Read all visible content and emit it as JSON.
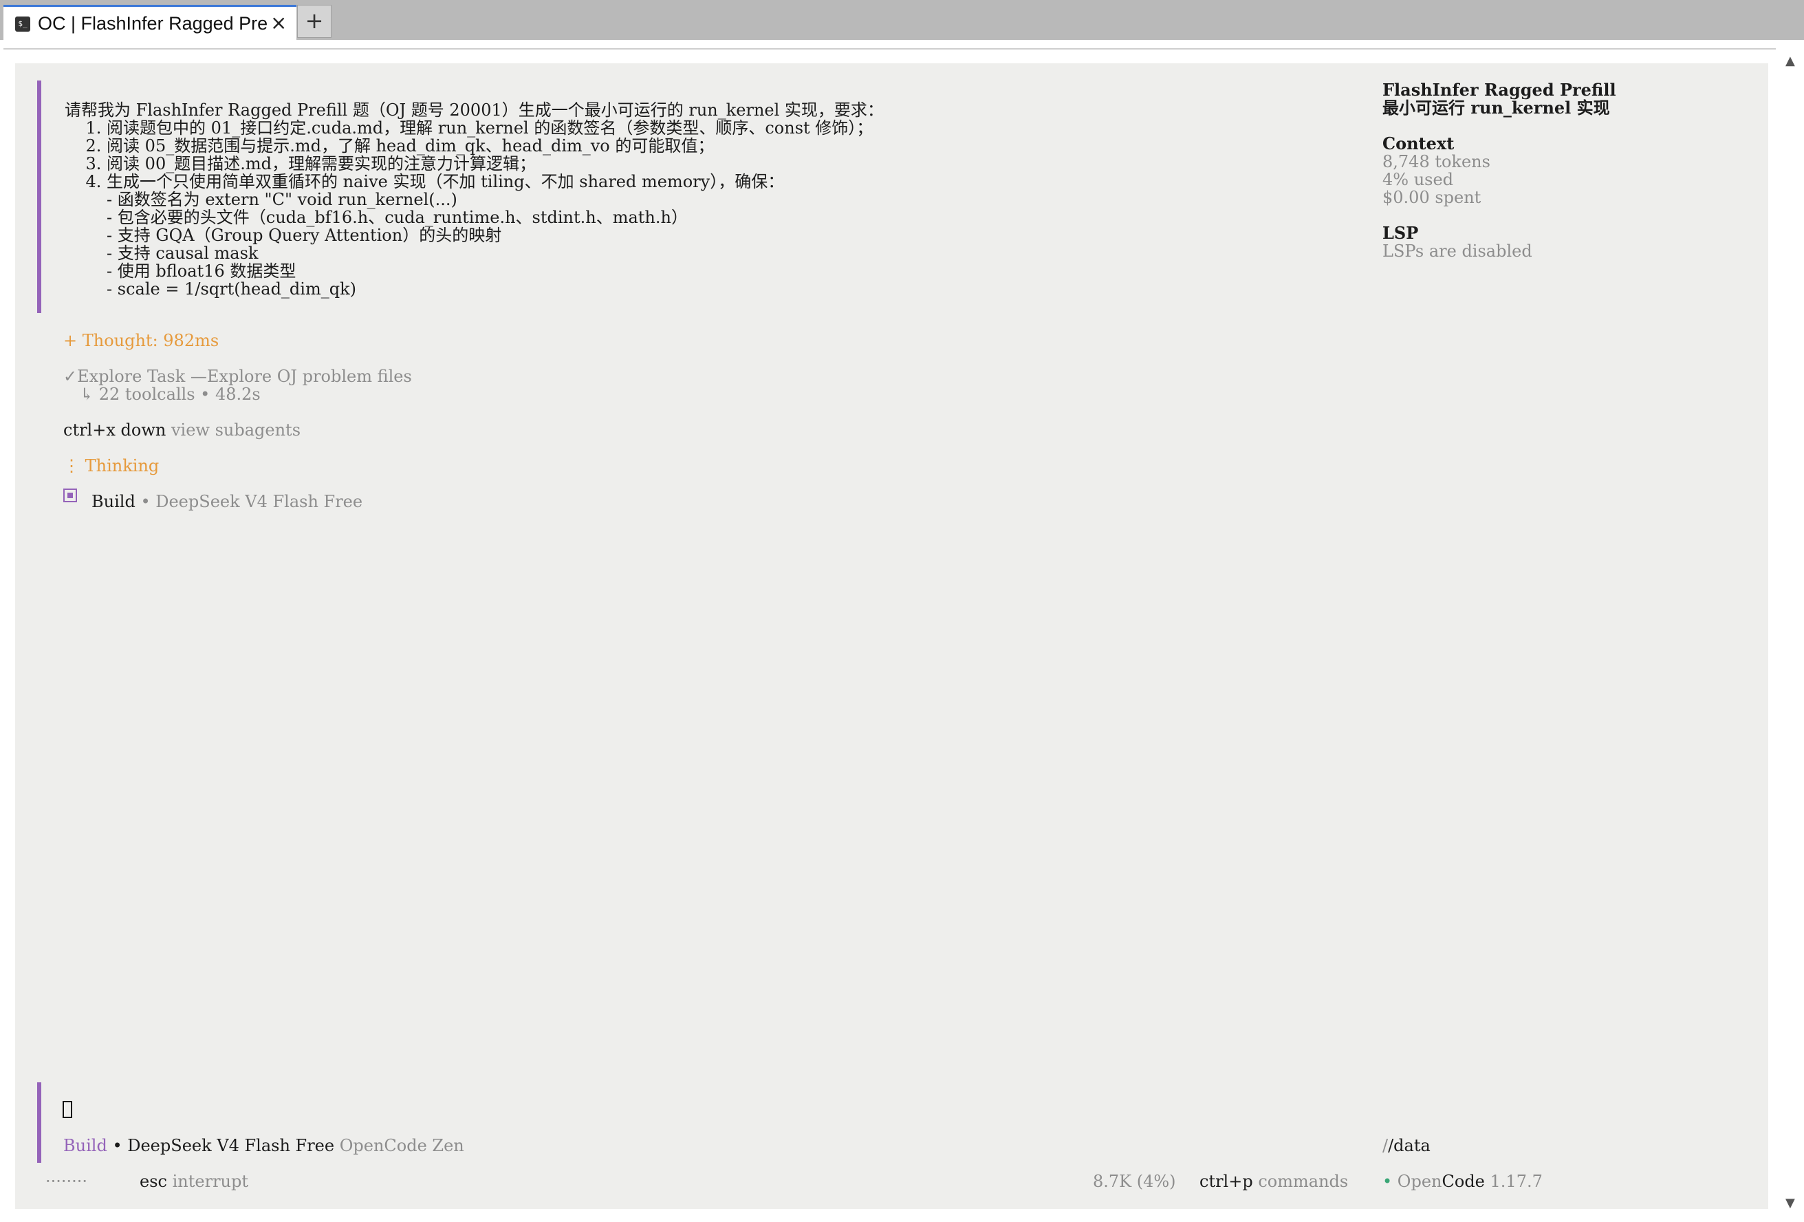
{
  "tab": {
    "icon_text": "$_",
    "title": "OC | FlashInfer Ragged Pre",
    "close_icon": "×",
    "new_tab_label": "+"
  },
  "scrollbar": {
    "up": "▲",
    "down": "▼"
  },
  "prompt": {
    "lines": [
      "请帮我为 FlashInfer Ragged Prefill 题（OJ 题号 20001）生成一个最小可运行的 run_kernel 实现，要求：",
      "    1. 阅读题包中的 01_接口约定.cuda.md，理解 run_kernel 的函数签名（参数类型、顺序、const 修饰）；",
      "    2. 阅读 05_数据范围与提示.md，了解 head_dim_qk、head_dim_vo 的可能取值；",
      "    3. 阅读 00_题目描述.md，理解需要实现的注意力计算逻辑；",
      "    4. 生成一个只使用简单双重循环的 naive 实现（不加 tiling、不加 shared memory），确保：",
      "        - 函数签名为 extern \"C\" void run_kernel(...)",
      "        - 包含必要的头文件（cuda_bf16.h、cuda_runtime.h、stdint.h、math.h）",
      "        - 支持 GQA（Group Query Attention）的头的映射",
      "        - 支持 causal mask",
      "        - 使用 bfloat16 数据类型",
      "        - scale = 1/sqrt(head_dim_qk)"
    ]
  },
  "thought": "+ Thought: 982ms",
  "explore": {
    "check": "✓",
    "label": "Explore Task —Explore OJ problem files",
    "sub": "↳ 22 toolcalls • 48.2s"
  },
  "subagents": {
    "key": "ctrl+x down",
    "label": "view subagents"
  },
  "thinking": {
    "glyph": "⋮",
    "label": "Thinking"
  },
  "build_status": {
    "mode": "Build",
    "model": "• DeepSeek V4 Flash Free"
  },
  "sidebar": {
    "title1": "FlashInfer Ragged Prefill",
    "title2": "最小可运行 run_kernel 实现",
    "context_heading": "Context",
    "tokens": "8,748 tokens",
    "used": "4% used",
    "spent": "$0.00 spent",
    "lsp_heading": "LSP",
    "lsp_status": "LSPs are disabled"
  },
  "input": {
    "mode": "Build",
    "model": "• DeepSeek V4 Flash Free",
    "provider": "OpenCode Zen",
    "cwd": "/data"
  },
  "footer": {
    "dots": "········",
    "esc_key": "esc",
    "esc_label": "interrupt",
    "usage": "8.7K (4%)",
    "cmd_key": "ctrl+p",
    "cmd_label": "commands",
    "bullet": "•",
    "app_open": "Open",
    "app_code": "Code",
    "version": "1.17.7"
  },
  "colors": {
    "accent": "#9463b9",
    "warning": "#e69a3c",
    "muted": "#8d8d8d",
    "terminal_bg": "#eeeeec",
    "tab_accent": "#3c78d8"
  }
}
